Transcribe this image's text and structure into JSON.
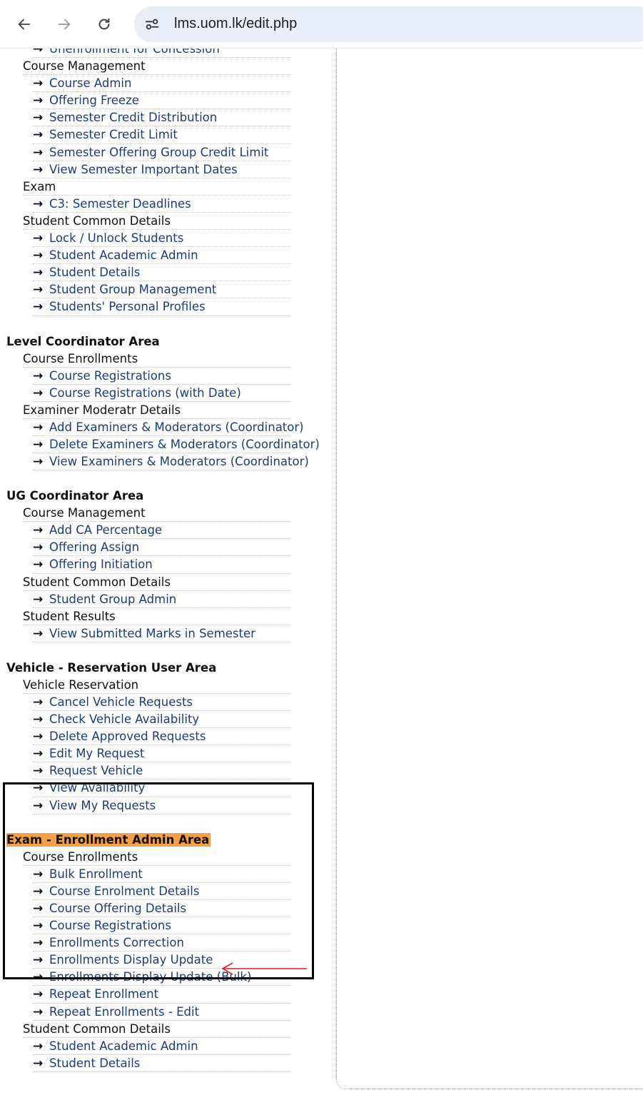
{
  "browser": {
    "url": "lms.uom.lk/edit.php"
  },
  "menu": [
    {
      "kind": "item",
      "label": "Unenrollment for Concession"
    },
    {
      "kind": "cat",
      "label": "Course Management"
    },
    {
      "kind": "item",
      "label": "Course Admin"
    },
    {
      "kind": "item",
      "label": "Offering Freeze"
    },
    {
      "kind": "item",
      "label": "Semester Credit Distribution"
    },
    {
      "kind": "item",
      "label": "Semester Credit Limit"
    },
    {
      "kind": "item",
      "label": "Semester Offering Group Credit Limit"
    },
    {
      "kind": "item",
      "label": "View Semester Important Dates"
    },
    {
      "kind": "cat",
      "label": "Exam"
    },
    {
      "kind": "item",
      "label": "C3: Semester Deadlines"
    },
    {
      "kind": "cat",
      "label": "Student Common Details"
    },
    {
      "kind": "item",
      "label": "Lock / Unlock Students"
    },
    {
      "kind": "item",
      "label": "Student Academic Admin"
    },
    {
      "kind": "item",
      "label": "Student Details"
    },
    {
      "kind": "item",
      "label": "Student Group Management"
    },
    {
      "kind": "item",
      "label": "Students' Personal Profiles"
    },
    {
      "kind": "spacer"
    },
    {
      "kind": "area",
      "label": "Level Coordinator Area"
    },
    {
      "kind": "cat",
      "label": "Course Enrollments"
    },
    {
      "kind": "item",
      "label": "Course Registrations"
    },
    {
      "kind": "item",
      "label": "Course Registrations (with Date)"
    },
    {
      "kind": "cat",
      "label": "Examiner Moderatr Details"
    },
    {
      "kind": "item",
      "label": "Add Examiners & Moderators (Coordinator)"
    },
    {
      "kind": "item",
      "label": "Delete Examiners & Moderators (Coordinator)"
    },
    {
      "kind": "item",
      "label": "View Examiners & Moderators (Coordinator)"
    },
    {
      "kind": "spacer"
    },
    {
      "kind": "area",
      "label": "UG Coordinator Area"
    },
    {
      "kind": "cat",
      "label": "Course Management"
    },
    {
      "kind": "item",
      "label": "Add CA Percentage"
    },
    {
      "kind": "item",
      "label": "Offering Assign"
    },
    {
      "kind": "item",
      "label": "Offering Initiation"
    },
    {
      "kind": "cat",
      "label": "Student Common Details"
    },
    {
      "kind": "item",
      "label": "Student Group Admin"
    },
    {
      "kind": "cat",
      "label": "Student Results"
    },
    {
      "kind": "item",
      "label": "View Submitted Marks in Semester"
    },
    {
      "kind": "spacer"
    },
    {
      "kind": "area",
      "label": "Vehicle - Reservation User Area"
    },
    {
      "kind": "cat",
      "label": "Vehicle Reservation"
    },
    {
      "kind": "item",
      "label": "Cancel Vehicle Requests"
    },
    {
      "kind": "item",
      "label": "Check Vehicle Availability"
    },
    {
      "kind": "item",
      "label": "Delete Approved Requests"
    },
    {
      "kind": "item",
      "label": "Edit My Request"
    },
    {
      "kind": "item",
      "label": "Request Vehicle"
    },
    {
      "kind": "item",
      "label": "View Availability"
    },
    {
      "kind": "item",
      "label": "View My Requests"
    },
    {
      "kind": "spacer"
    },
    {
      "kind": "area",
      "label": "Exam - Enrollment Admin Area",
      "highlight": true
    },
    {
      "kind": "cat",
      "label": "Course Enrollments"
    },
    {
      "kind": "item",
      "label": "Bulk Enrollment"
    },
    {
      "kind": "item",
      "label": "Course Enrolment Details"
    },
    {
      "kind": "item",
      "label": "Course Offering Details"
    },
    {
      "kind": "item",
      "label": "Course Registrations"
    },
    {
      "kind": "item",
      "label": "Enrollments Correction"
    },
    {
      "kind": "item",
      "label": "Enrollments Display Update"
    },
    {
      "kind": "item",
      "label": "Enrollments Display Update (Bulk)"
    },
    {
      "kind": "item",
      "label": "Repeat Enrollment"
    },
    {
      "kind": "item",
      "label": "Repeat Enrollments - Edit"
    },
    {
      "kind": "cat",
      "label": "Student Common Details"
    },
    {
      "kind": "item",
      "label": "Student Academic Admin"
    },
    {
      "kind": "item",
      "label": "Student Details"
    }
  ],
  "colors": {
    "link": "#1c3d77",
    "highlight": "#f5a044",
    "annotation_arrow": "#e0201f",
    "annotation_box": "#000000"
  }
}
